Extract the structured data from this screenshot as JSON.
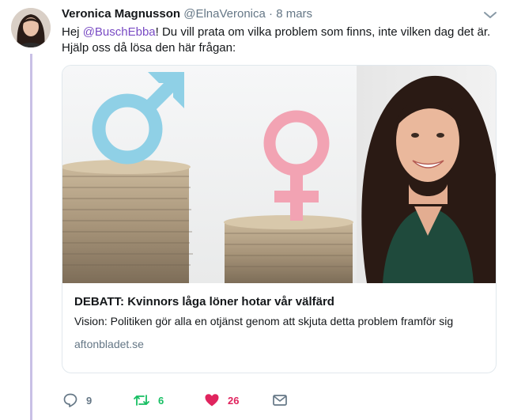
{
  "tweet": {
    "author_name": "Veronica Magnusson",
    "author_handle": "@ElnaVeronica",
    "separator": "·",
    "date": "8 mars",
    "text_before": "Hej ",
    "mention": "@BuschEbba",
    "text_after": "! Du vill prata om vilka problem som finns, inte vilken dag det är. Hjälp oss då lösa den här frågan:"
  },
  "card": {
    "title": "DEBATT: Kvinnors låga löner hotar vår välfärd",
    "description": "Vision: Politiken gör alla en otjänst genom att skjuta detta problem framför sig",
    "domain": "aftonbladet.se"
  },
  "actions": {
    "reply_count": "9",
    "retweet_count": "6",
    "like_count": "26"
  },
  "colors": {
    "mention": "#794bc4",
    "retweet": "#17bf63",
    "like": "#e0245e",
    "muted": "#657786",
    "thread_line": "#c9c0e6",
    "male_symbol": "#8fd0e6",
    "female_symbol": "#f2a3b3"
  },
  "icons": {
    "reply": "reply-icon",
    "retweet": "retweet-icon",
    "like": "heart-icon",
    "dm": "envelope-icon",
    "caret": "chevron-down-icon"
  }
}
